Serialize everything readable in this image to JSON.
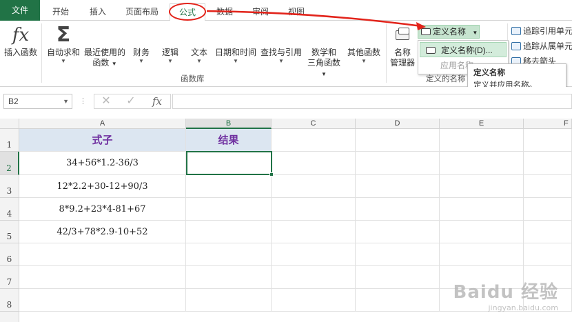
{
  "tabs": [
    {
      "label": "文件"
    },
    {
      "label": "开始"
    },
    {
      "label": "插入"
    },
    {
      "label": "页面布局"
    },
    {
      "label": "公式"
    },
    {
      "label": "数据"
    },
    {
      "label": "审阅"
    },
    {
      "label": "视图"
    }
  ],
  "ribbon": {
    "insert_function": "插入函数",
    "autosum": "自动求和",
    "recent_line1": "最近使用的",
    "recent_line2": "函数",
    "financial": "财务",
    "logical": "逻辑",
    "text": "文本",
    "datetime": "日期和时间",
    "lookup": "查找与引用",
    "math_line1": "数学和",
    "math_line2": "三角函数",
    "other": "其他函数",
    "group_library": "函数库",
    "name_manager_line1": "名称",
    "name_manager_line2": "管理器",
    "define_name": "定义名称",
    "group_defined_names": "定义的名称",
    "trace_precedents": "追踪引用单元",
    "trace_dependents": "追踪从属单元",
    "remove_arrows": "移去箭头"
  },
  "dropdown": {
    "item_define": "定义名称(D)...",
    "item_apply": "应用名称"
  },
  "tooltip": {
    "title": "定义名称",
    "desc": "定义并应用名称。"
  },
  "formula_bar": {
    "name_box": "B2",
    "dots": "⋮",
    "cancel": "✕",
    "enter": "✓",
    "fx": "fx"
  },
  "columns": [
    "A",
    "B",
    "C",
    "D",
    "E",
    "F"
  ],
  "rows": [
    "1",
    "2",
    "3",
    "4",
    "5",
    "6",
    "7",
    "8"
  ],
  "cells": {
    "A1": "式子",
    "B1": "结果",
    "A2": "34+56*1.2-36/3",
    "A3": "12*2.2+30-12+90/3",
    "A4": "8*9.2+23*4-81+67",
    "A5": "42/3+78*2.9-10+52"
  },
  "watermark": {
    "line1": "Baidu 经验",
    "line2": "jingyan.baidu.com"
  },
  "colors": {
    "accent": "#217346",
    "annotation": "#e2231a",
    "header_fill": "#dce6f1",
    "header_text": "#7030a0"
  }
}
